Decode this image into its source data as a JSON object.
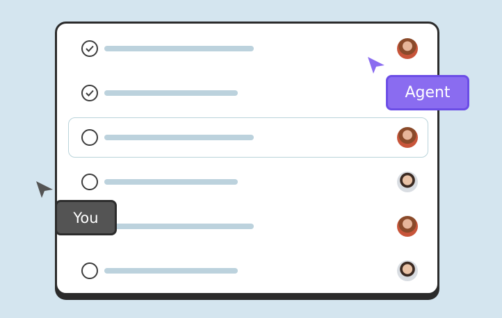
{
  "tasks": [
    {
      "done": true,
      "assignee": "agent"
    },
    {
      "done": true,
      "assignee": ""
    },
    {
      "done": false,
      "assignee": "agent"
    },
    {
      "done": false,
      "assignee": "you"
    },
    {
      "done": false,
      "assignee": "agent"
    },
    {
      "done": false,
      "assignee": "you"
    }
  ],
  "cursors": {
    "agent": {
      "label": "Agent",
      "color": "#8a6cf0"
    },
    "you": {
      "label": "You",
      "color": "#545454"
    }
  },
  "icons": {
    "check": "checkmark-icon",
    "empty": "empty-circle-icon",
    "agent_avatar": "woman-avatar",
    "you_avatar": "man-avatar",
    "pointer": "cursor-arrow-icon"
  }
}
